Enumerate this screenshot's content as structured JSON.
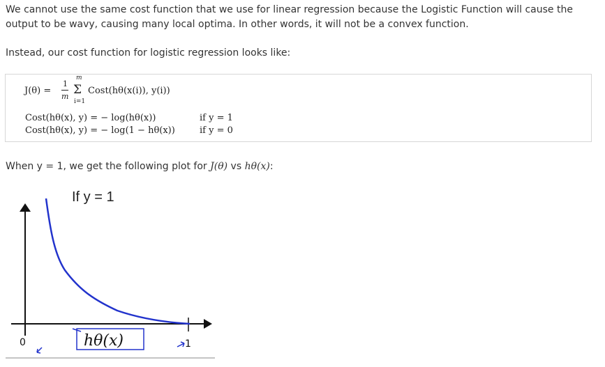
{
  "paragraphs": {
    "p1": "We cannot use the same cost function that we use for linear regression because the Logistic Function will cause the output to be wavy, causing many local optima. In other words, it will not be a convex function.",
    "p2": "Instead, our cost function for logistic regression looks like:",
    "p3_prefix": "When y = 1, we get the following plot for ",
    "p3_J": "J(θ)",
    "p3_mid": " vs ",
    "p3_h": "hθ(x)",
    "p3_suffix": ":"
  },
  "formula": {
    "j_lhs": "J(θ) =",
    "frac_num": "1",
    "frac_den": "m",
    "sum_upper": "m",
    "sum_sym": "Σ",
    "sum_lower": "i=1",
    "j_rhs": "Cost(hθ(x(i)), y(i))",
    "cost1": "Cost(hθ(x), y) = − log(hθ(x))",
    "cost0": "Cost(hθ(x), y) = − log(1 − hθ(x))",
    "cond1": "if y = 1",
    "cond0": "if y = 0"
  },
  "plot": {
    "title": "If y = 1",
    "x_start_label": "0",
    "x_end_label": "1",
    "x_axis_label": "hθ(x)",
    "curve_color": "#2233cc"
  }
}
